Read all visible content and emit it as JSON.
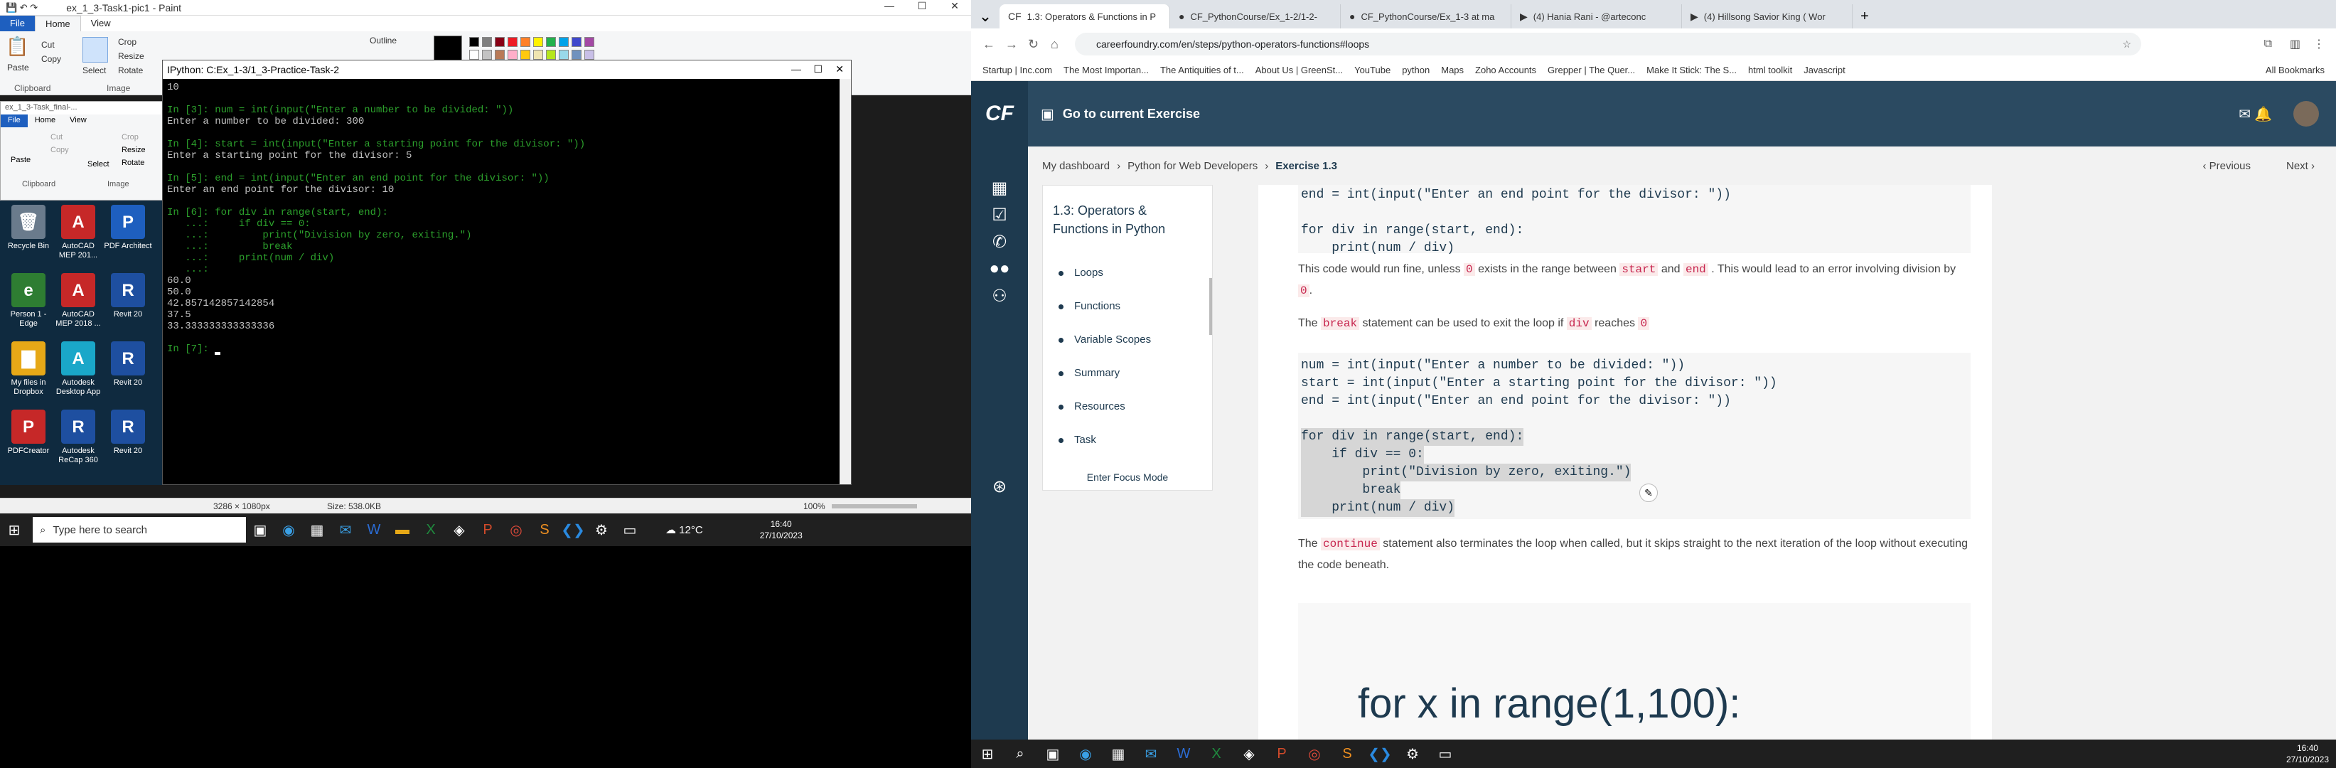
{
  "paint": {
    "title": "ex_1_3-Task1-pic1 - Paint",
    "tabs": [
      "File",
      "Home",
      "View"
    ],
    "clipboard": {
      "paste": "Paste",
      "cut": "Cut",
      "copy": "Copy",
      "group": "Clipboard"
    },
    "image": {
      "select": "Select",
      "crop": "Crop",
      "resize": "Resize",
      "rotate": "Rotate",
      "group": "Image"
    },
    "outline": "Outline",
    "second_window_title": "ex_1_3-Task_final-...",
    "status": {
      "dimensions": "3286 × 1080px",
      "size": "Size: 538.0KB",
      "zoom": "100%"
    }
  },
  "desktop_icons": [
    {
      "label": "Recycle Bin",
      "color": "#6a7b8c",
      "glyph": "🗑"
    },
    {
      "label": "AutoCAD MEP 201...",
      "color": "#c62828",
      "glyph": "A"
    },
    {
      "label": "PDF Architect",
      "color": "#1e5fbf",
      "glyph": "P"
    },
    {
      "label": "Person 1 - Edge",
      "color": "#2e7d32",
      "glyph": "e"
    },
    {
      "label": "AutoCAD MEP 2018 ...",
      "color": "#c62828",
      "glyph": "A"
    },
    {
      "label": "Revit 20",
      "color": "#1e4fa0",
      "glyph": "R"
    },
    {
      "label": "My files in Dropbox",
      "color": "#e6a817",
      "glyph": "▇"
    },
    {
      "label": "Autodesk Desktop App",
      "color": "#1aa7c9",
      "glyph": "A"
    },
    {
      "label": "Revit 20",
      "color": "#1e4fa0",
      "glyph": "R"
    },
    {
      "label": "PDFCreator",
      "color": "#c62828",
      "glyph": "P"
    },
    {
      "label": "Autodesk ReCap 360",
      "color": "#1e4fa0",
      "glyph": "R"
    },
    {
      "label": "Revit 20",
      "color": "#1e4fa0",
      "glyph": "R"
    }
  ],
  "console": {
    "title": "IPython: C:Ex_1-3/1_3-Practice-Task-2",
    "lines": [
      {
        "cls": "c-grey",
        "text": "10"
      },
      {
        "cls": "c-grey",
        "text": ""
      },
      {
        "cls": "c-in",
        "text": "In [3]: num = int(input(\"Enter a number to be divided: \"))"
      },
      {
        "cls": "c-grey",
        "text": "Enter a number to be divided: 300"
      },
      {
        "cls": "c-grey",
        "text": ""
      },
      {
        "cls": "c-in",
        "text": "In [4]: start = int(input(\"Enter a starting point for the divisor: \"))"
      },
      {
        "cls": "c-grey",
        "text": "Enter a starting point for the divisor: 5"
      },
      {
        "cls": "c-grey",
        "text": ""
      },
      {
        "cls": "c-in",
        "text": "In [5]: end = int(input(\"Enter an end point for the divisor: \"))"
      },
      {
        "cls": "c-grey",
        "text": "Enter an end point for the divisor: 10"
      },
      {
        "cls": "c-grey",
        "text": ""
      },
      {
        "cls": "c-in",
        "text": "In [6]: for div in range(start, end):"
      },
      {
        "cls": "c-in",
        "text": "   ...:     if div == 0:"
      },
      {
        "cls": "c-in",
        "text": "   ...:         print(\"Division by zero, exiting.\")"
      },
      {
        "cls": "c-in",
        "text": "   ...:         break"
      },
      {
        "cls": "c-in",
        "text": "   ...:     print(num / div)"
      },
      {
        "cls": "c-in",
        "text": "   ...:"
      },
      {
        "cls": "c-grey",
        "text": "60.0"
      },
      {
        "cls": "c-grey",
        "text": "50.0"
      },
      {
        "cls": "c-grey",
        "text": "42.857142857142854"
      },
      {
        "cls": "c-grey",
        "text": "37.5"
      },
      {
        "cls": "c-grey",
        "text": "33.333333333333336"
      },
      {
        "cls": "c-grey",
        "text": ""
      },
      {
        "cls": "c-in",
        "text": "In [7]: "
      }
    ]
  },
  "taskbar_left": {
    "search_placeholder": "Type here to search",
    "weather": "12°C",
    "time": "16:40",
    "date": "27/10/2023"
  },
  "browser": {
    "tabs": [
      {
        "label": "1.3: Operators & Functions in P",
        "fav": "CF"
      },
      {
        "label": "CF_PythonCourse/Ex_1-2/1-2-",
        "fav": "●"
      },
      {
        "label": "CF_PythonCourse/Ex_1-3 at ma",
        "fav": "●"
      },
      {
        "label": "(4) Hania Rani - @arteconc",
        "fav": "▶"
      },
      {
        "label": "(4) Hillsong Savior King ( Wor",
        "fav": "▶"
      }
    ],
    "url": "careerfoundry.com/en/steps/python-operators-functions#loops",
    "bookmarks": [
      "Startup | Inc.com",
      "The Most Importan...",
      "The Antiquities of t...",
      "About Us | GreenSt...",
      "YouTube",
      "python",
      "Maps",
      "Zoho Accounts",
      "Grepper | The Quer...",
      "Make It Stick: The S...",
      "html toolkit",
      "Javascript",
      "All Bookmarks"
    ]
  },
  "cf": {
    "logo": "CF",
    "top_link": "Go to current Exercise",
    "breadcrumb": [
      "My dashboard",
      "Python for Web Developers",
      "Exercise 1.3"
    ],
    "prev": "Previous",
    "next": "Next",
    "toc_title": "1.3: Operators & Functions in Python",
    "toc_items": [
      "Loops",
      "Functions",
      "Variable Scopes",
      "Summary",
      "Resources",
      "Task"
    ],
    "focus": "Enter Focus Mode"
  },
  "article": {
    "code1_a": "end = int(input(\"Enter an end point for the divisor: \"))",
    "code1_b": "for div in range(start, end):",
    "code1_c": "    print(num / div)",
    "p1_a": "This code would run fine, unless",
    "p1_b": "exists in the range between",
    "p1_c": "and",
    "p1_d": ". This would lead to an error involving division by",
    "zero": "0",
    "start": "start",
    "end": "end",
    "p2_a": "The",
    "break": "break",
    "p2_b": "statement can be used to exit the loop if",
    "div": "div",
    "p2_c": "reaches",
    "code2": [
      "num = int(input(\"Enter a number to be divided: \"))",
      "start = int(input(\"Enter a starting point for the divisor: \"))",
      "end = int(input(\"Enter an end point for the divisor: \"))",
      "",
      "for div in range(start, end):",
      "    if div == 0:",
      "        print(\"Division by zero, exiting.\")",
      "        break",
      "    print(num / div)"
    ],
    "continue": "continue",
    "p3": "statement also terminates the loop when called, but it skips straight to the next iteration of the loop without executing the code beneath.",
    "big_code": "for x in range(1,100):"
  },
  "taskbar_right": {
    "time": "16:40",
    "date": "27/10/2023"
  }
}
